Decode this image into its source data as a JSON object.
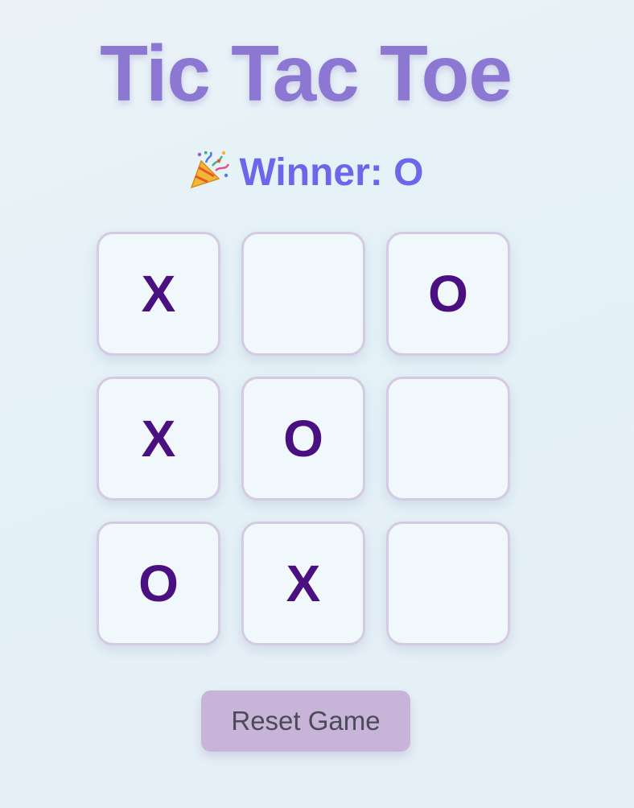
{
  "game": {
    "title": "Tic Tac Toe",
    "status_icon": "party-popper-icon",
    "status_text": "Winner: O",
    "board": [
      "X",
      "",
      "O",
      "X",
      "O",
      "",
      "O",
      "X",
      ""
    ],
    "reset_label": "Reset Game"
  },
  "colors": {
    "title": "#8c77d3",
    "status": "#6b66ea",
    "mark": "#4a0f80",
    "cell_border": "#d4cae2",
    "cell_background": "#f1f8fb",
    "reset_background": "#c9b4d9"
  }
}
